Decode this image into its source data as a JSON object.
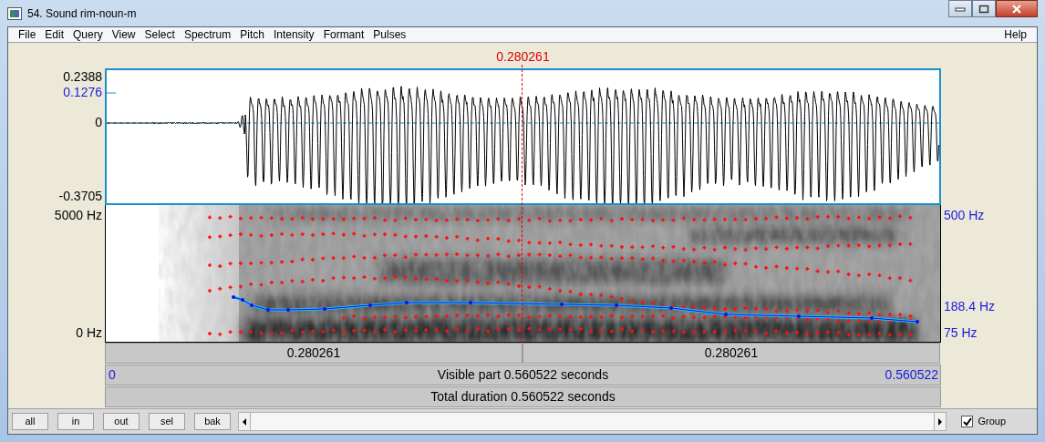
{
  "window": {
    "title": "54. Sound rim-noun-m"
  },
  "menu": [
    "File",
    "Edit",
    "Query",
    "View",
    "Select",
    "Spectrum",
    "Pitch",
    "Intensity",
    "Formant",
    "Pulses"
  ],
  "help_menu": "Help",
  "cursor": {
    "time": "0.280261"
  },
  "waveform": {
    "y_max": "0.2388",
    "y_mark": "0.1276",
    "y_zero": "0",
    "y_min": "-0.3705"
  },
  "spectrogram": {
    "freq_max": "5000 Hz",
    "freq_min": "0 Hz",
    "pitch_max": "500 Hz",
    "pitch_value": "188.4 Hz",
    "pitch_min": "75 Hz"
  },
  "time_bars": {
    "left_segment": "0.280261",
    "right_segment": "0.280261",
    "visible_start": "0",
    "visible_label": "Visible part 0.560522 seconds",
    "visible_end": "0.560522",
    "total_label": "Total duration 0.560522 seconds"
  },
  "buttons": [
    "all",
    "in",
    "out",
    "sel",
    "bak"
  ],
  "group": {
    "label": "Group",
    "checked": true
  }
}
